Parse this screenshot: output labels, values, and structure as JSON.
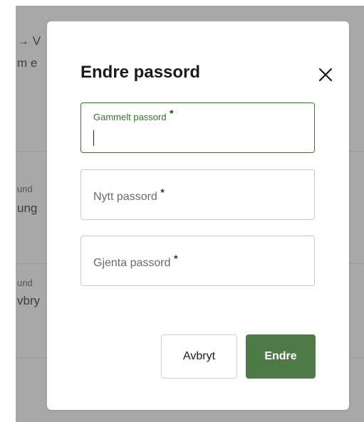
{
  "background": {
    "fragments": [
      "→ V",
      "m e",
      "und",
      "ung",
      "und",
      "vbry"
    ]
  },
  "dialog": {
    "title": "Endre passord",
    "close_icon": "close-icon",
    "fields": [
      {
        "label": "Gammelt passord",
        "required_mark": "*",
        "value": "",
        "focused": true
      },
      {
        "label": "Nytt passord",
        "required_mark": "*",
        "value": "",
        "focused": false
      },
      {
        "label": "Gjenta passord",
        "required_mark": "*",
        "value": "",
        "focused": false
      }
    ],
    "cancel_label": "Avbryt",
    "submit_label": "Endre"
  },
  "colors": {
    "accent": "#4f7a48",
    "focus_border": "#3f6b38",
    "backdrop": "#a9a8a6"
  }
}
